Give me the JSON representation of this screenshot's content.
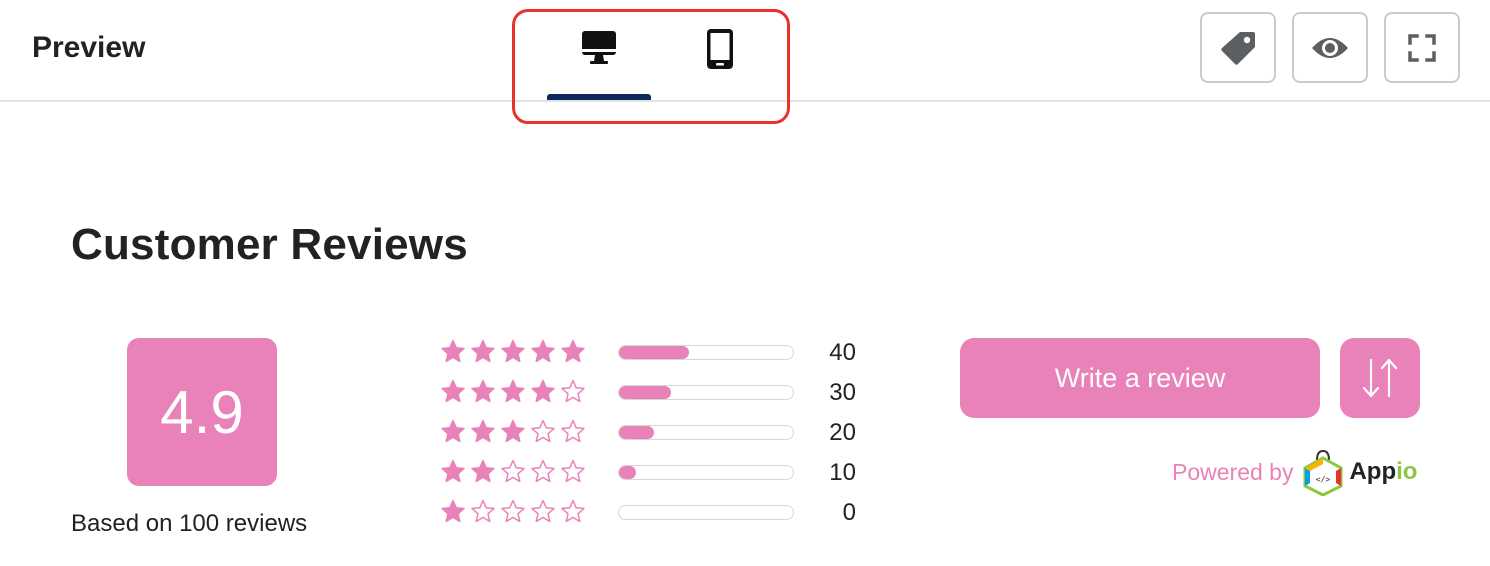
{
  "header": {
    "title": "Preview",
    "device_toggle": {
      "options": [
        {
          "name": "desktop",
          "icon": "desktop-icon",
          "active": true
        },
        {
          "name": "mobile",
          "icon": "mobile-icon",
          "active": false
        }
      ],
      "highlight_color": "#e8322c",
      "active_indicator_color": "#0b2a5b"
    },
    "actions": [
      {
        "icon": "tag-icon"
      },
      {
        "icon": "eye-icon"
      },
      {
        "icon": "fullscreen-icon"
      }
    ]
  },
  "reviews": {
    "title": "Customer Reviews",
    "average_score": "4.9",
    "based_on": "Based on 100 reviews",
    "accent_color": "#e882b8",
    "breakdown": [
      {
        "stars": 5,
        "count": "40",
        "fill": 0.4
      },
      {
        "stars": 4,
        "count": "30",
        "fill": 0.3
      },
      {
        "stars": 3,
        "count": "20",
        "fill": 0.2
      },
      {
        "stars": 2,
        "count": "10",
        "fill": 0.1
      },
      {
        "stars": 1,
        "count": "0",
        "fill": 0.0
      }
    ],
    "write_review_label": "Write a review",
    "sort_icon": "sort-arrows-icon",
    "powered_by": "Powered by",
    "brand_name_main": "App",
    "brand_name_accent": "io"
  }
}
